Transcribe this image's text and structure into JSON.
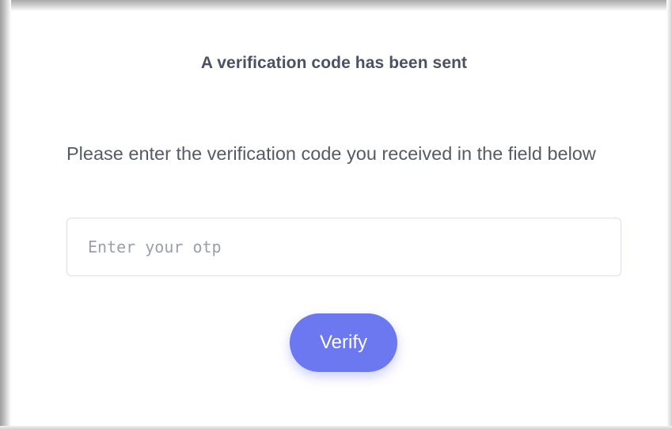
{
  "dialog": {
    "title": "A verification code has been sent",
    "instruction": "Please enter the verification code you received in the field below"
  },
  "otp": {
    "placeholder": "Enter your otp",
    "value": ""
  },
  "actions": {
    "verify_label": "Verify"
  },
  "colors": {
    "accent": "#6c78f0",
    "text": "#555b66",
    "title": "#4a5261",
    "input_border": "#dcdfe5"
  }
}
